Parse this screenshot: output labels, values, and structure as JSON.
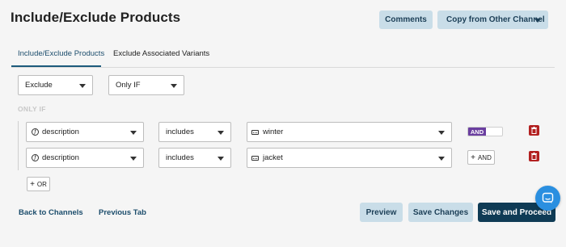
{
  "header": {
    "title": "Include/Exclude Products",
    "comments_label": "Comments",
    "copy_label": "Copy from Other Channel"
  },
  "tabs": [
    {
      "label": "Include/Exclude Products",
      "active": true
    },
    {
      "label": "Exclude Associated Variants",
      "active": false
    }
  ],
  "filters": {
    "mode_value": "Exclude",
    "condition_value": "Only IF",
    "section_label": "ONLY IF"
  },
  "rules": [
    {
      "field": "description",
      "operator": "includes",
      "value": "winter"
    },
    {
      "field": "description",
      "operator": "includes",
      "value": "jacket"
    }
  ],
  "logic": {
    "toggle_label": "AND",
    "add_and_label": "AND",
    "add_or_label": "OR"
  },
  "footer": {
    "back_label": "Back to Channels",
    "prev_label": "Previous Tab",
    "preview_label": "Preview",
    "save_label": "Save Changes",
    "proceed_label": "Save and Proceed"
  },
  "colors": {
    "primary_dark": "#0f3b55",
    "primary_light": "#c9dde8",
    "toggle_accent": "#6b3fa0",
    "delete_red": "#b22020",
    "chat_blue": "#2a8fe0"
  },
  "icons": {
    "field": "function-icon",
    "value": "keyboard-icon",
    "delete": "trash-icon",
    "chat": "chat-icon"
  }
}
